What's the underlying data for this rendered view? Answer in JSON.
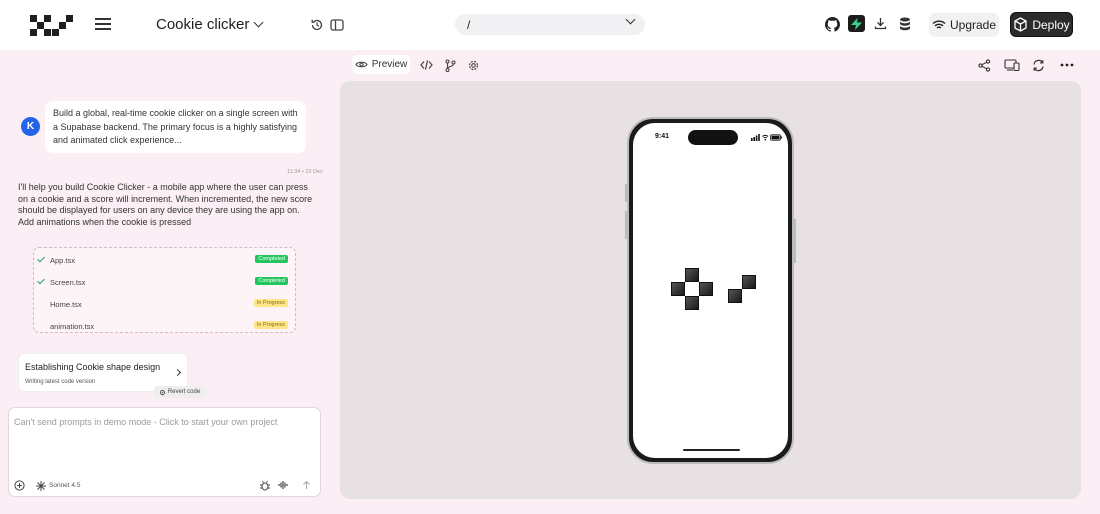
{
  "header": {
    "project_title": "Cookie clicker",
    "path": "/",
    "upgrade_label": "Upgrade",
    "deploy_label": "Deploy",
    "icons": [
      "logo",
      "menu-icon",
      "history-icon",
      "sidebar-icon",
      "github-icon",
      "supabase-icon",
      "download-icon",
      "database-icon",
      "wifi-icon",
      "box-icon"
    ]
  },
  "chat": {
    "user_initial": "K",
    "user_message": "Build a global, real-time cookie clicker on a single screen with a Supabase backend. The primary focus is a highly satisfying and animated click experience...",
    "timestamp": "11:34 • 22 Dec",
    "assistant_message": "I'll help you build Cookie Clicker - a mobile app where the user can press on a cookie and a score will increment. When incremented, the new score should be displayed for users on any device they are using the app on. Add animations when the cookie is pressed",
    "files": [
      {
        "name": "App.tsx",
        "status": "Completed",
        "done": true
      },
      {
        "name": "Screen.tsx",
        "status": "Completed",
        "done": true
      },
      {
        "name": "Home.tsx",
        "status": "In Progress",
        "done": false
      },
      {
        "name": "animation.tsx",
        "status": "In Progress",
        "done": false
      }
    ],
    "action": {
      "title": "Establishing  Cookie shape design",
      "subtitle": "Writing latest code version"
    },
    "revert_label": "Revert code",
    "prompt_placeholder": "Can't send prompts in demo mode - Click to start your own project",
    "model": "Sonnet 4.5"
  },
  "preview": {
    "tab_label": "Preview",
    "phone_time": "9:41"
  },
  "colors": {
    "accent_blue": "#2563eb",
    "completed_green": "#22c55e",
    "progress_yellow": "#fde68a",
    "background_pink": "#fbeef5",
    "preview_bg": "#e7e1e4"
  }
}
